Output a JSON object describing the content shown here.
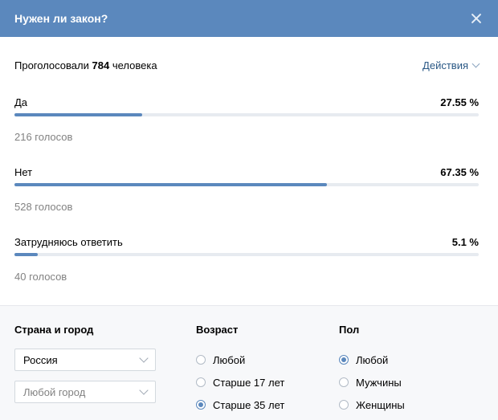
{
  "header": {
    "title": "Нужен ли закон?"
  },
  "summary": {
    "prefix": "Проголосовали",
    "count": "784",
    "suffix": "человека",
    "actions_label": "Действия"
  },
  "options": [
    {
      "label": "Да",
      "percent_text": "27.55 %",
      "percent": 27.55,
      "votes": "216 голосов"
    },
    {
      "label": "Нет",
      "percent_text": "67.35 %",
      "percent": 67.35,
      "votes": "528 голосов"
    },
    {
      "label": "Затрудняюсь ответить",
      "percent_text": "5.1 %",
      "percent": 5.1,
      "votes": "40 голосов"
    }
  ],
  "filters": {
    "country_heading": "Страна и город",
    "country_value": "Россия",
    "city_placeholder": "Любой город",
    "age_heading": "Возраст",
    "age_options": [
      {
        "label": "Любой",
        "selected": false
      },
      {
        "label": "Старше 17 лет",
        "selected": false
      },
      {
        "label": "Старше 35 лет",
        "selected": true
      }
    ],
    "sex_heading": "Пол",
    "sex_options": [
      {
        "label": "Любой",
        "selected": true
      },
      {
        "label": "Мужчины",
        "selected": false
      },
      {
        "label": "Женщины",
        "selected": false
      }
    ]
  },
  "colors": {
    "accent": "#5b88bd",
    "bar_track": "#e7ebf0",
    "footer_bg": "#f7f8fa",
    "link": "#2a5885"
  }
}
